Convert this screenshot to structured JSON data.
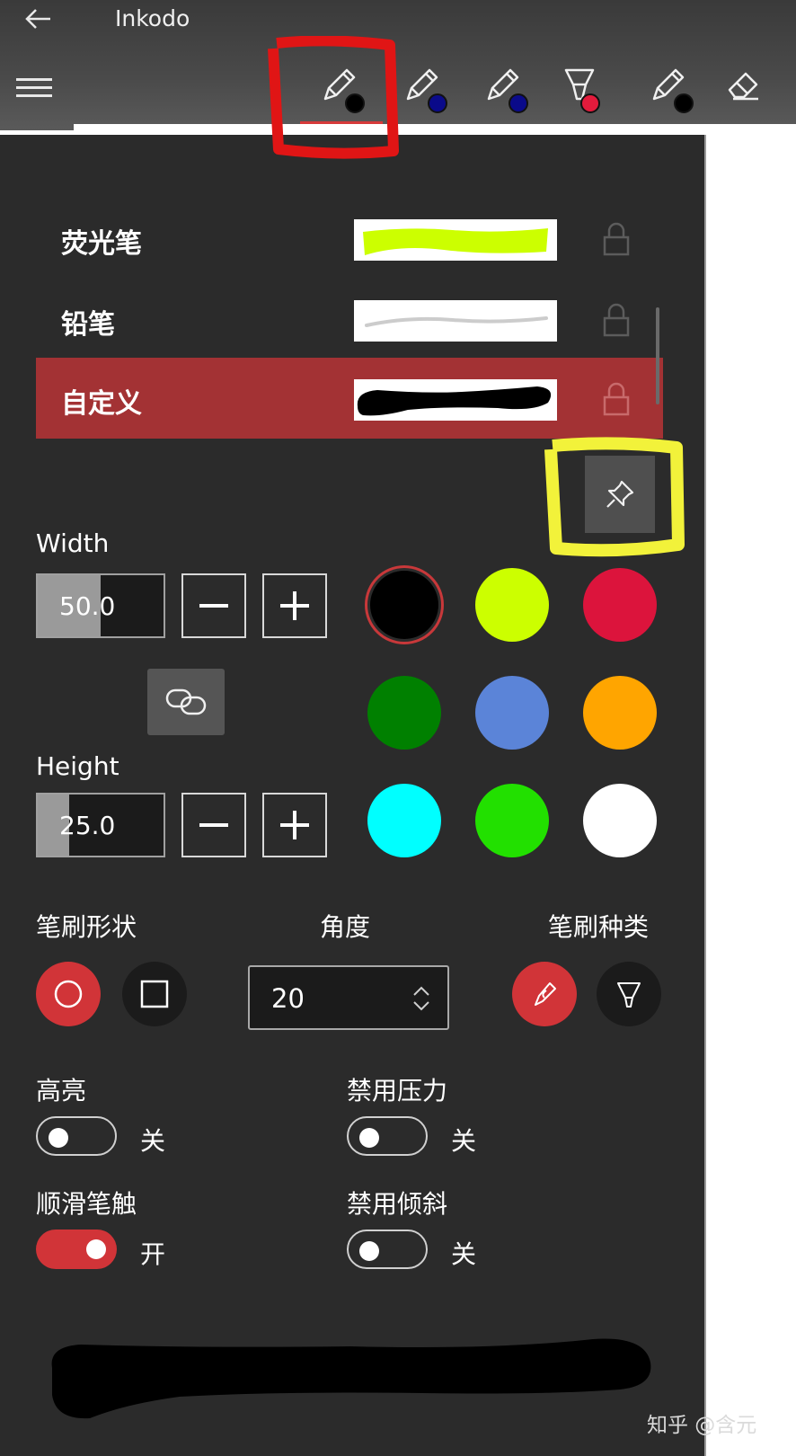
{
  "titlebar": {
    "title": "Inkodo"
  },
  "toolbar": {
    "tools": [
      {
        "name": "pen-1",
        "dot_color": "#000000",
        "selected": true
      },
      {
        "name": "pen-2",
        "dot_color": "#0a0a8a",
        "selected": false
      },
      {
        "name": "pen-3",
        "dot_color": "#0a0a8a",
        "selected": false
      },
      {
        "name": "highlighter",
        "dot_color": "#e31b3c",
        "selected": false
      },
      {
        "name": "pen-4",
        "dot_color": "#000000",
        "selected": false
      },
      {
        "name": "eraser",
        "dot_color": "",
        "selected": false
      }
    ]
  },
  "presets": [
    {
      "label": "荧光笔",
      "preview_color": "#ccff00",
      "selected": false
    },
    {
      "label": "铅笔",
      "preview_color": "#cccccc",
      "selected": false
    },
    {
      "label": "自定义",
      "preview_color": "#000000",
      "selected": true
    }
  ],
  "size": {
    "width_label": "Width",
    "width_value": "50.0",
    "width_fill_fraction": 0.5,
    "height_label": "Height",
    "height_value": "25.0",
    "height_fill_fraction": 0.25
  },
  "colors": [
    "#000000",
    "#ccff00",
    "#dc143c",
    "#008000",
    "#5b84d8",
    "#ffa500",
    "#00ffff",
    "#22e000",
    "#ffffff"
  ],
  "selected_color": "#000000",
  "brush": {
    "shape_label": "笔刷形状",
    "angle_label": "角度",
    "angle_value": "20",
    "type_label": "笔刷种类"
  },
  "toggles": {
    "highlight": {
      "label": "高亮",
      "state": "关",
      "on": false
    },
    "disable_pressure": {
      "label": "禁用压力",
      "state": "关",
      "on": false
    },
    "smooth": {
      "label": "顺滑笔触",
      "state": "开",
      "on": true
    },
    "disable_tilt": {
      "label": "禁用倾斜",
      "state": "关",
      "on": false
    }
  },
  "watermark": "知乎 @含元",
  "accent_color": "#d13438"
}
